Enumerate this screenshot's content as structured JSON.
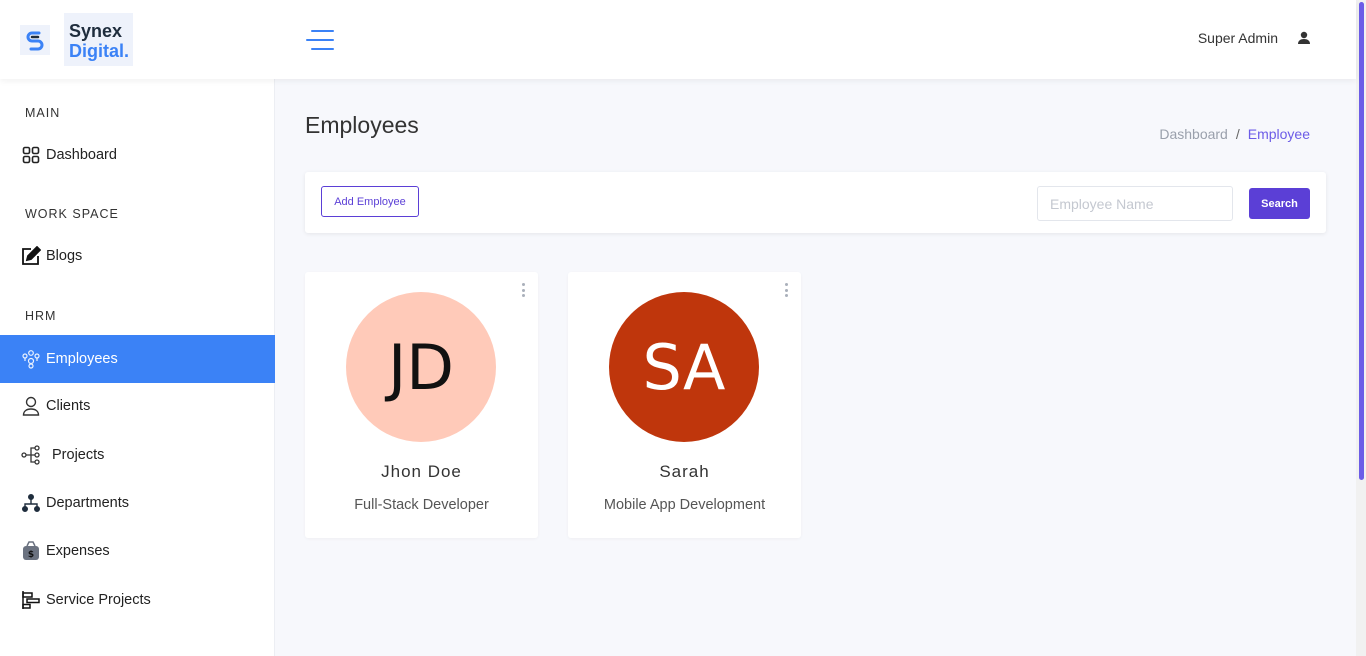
{
  "brand": {
    "line1": "Synex",
    "line2": "Digital.",
    "accent": "#3b82f6"
  },
  "header": {
    "user_name": "Super Admin"
  },
  "sidebar": {
    "sections": [
      "MAIN",
      "WORK SPACE",
      "HRM"
    ],
    "items": [
      {
        "label": "Dashboard",
        "icon": "dashboard-grid-icon"
      },
      {
        "label": "Blogs",
        "icon": "edit-note-icon"
      },
      {
        "label": "Employees",
        "icon": "employees-icon",
        "active": true
      },
      {
        "label": "Clients",
        "icon": "user-icon"
      },
      {
        "label": "Projects",
        "icon": "project-tree-icon"
      },
      {
        "label": "Departments",
        "icon": "org-chart-icon"
      },
      {
        "label": "Expenses",
        "icon": "money-bag-icon"
      },
      {
        "label": "Service Projects",
        "icon": "gantt-icon"
      }
    ],
    "active_color": "#3b82f6"
  },
  "page": {
    "title": "Employees",
    "breadcrumb": {
      "parent": "Dashboard",
      "separator": "/",
      "current": "Employee"
    }
  },
  "toolbar": {
    "add_label": "Add Employee",
    "search_placeholder": "Employee Name",
    "search_value": "",
    "search_label": "Search",
    "primary_color": "#5b3fd6"
  },
  "employees": [
    {
      "initials": "JD",
      "name": "Jhon Doe",
      "role": "Full-Stack Developer",
      "avatar_bg": "#ffcab9",
      "avatar_fg": "#111111"
    },
    {
      "initials": "SA",
      "name": "Sarah",
      "role": "Mobile App Development",
      "avatar_bg": "#bf360c",
      "avatar_fg": "#ffffff"
    }
  ]
}
